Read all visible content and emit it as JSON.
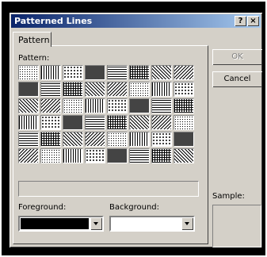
{
  "window": {
    "title": "Patterned Lines",
    "help_label": "?",
    "close_label": "×"
  },
  "tabs": [
    {
      "label": "Pattern"
    }
  ],
  "pattern_label": "Pattern:",
  "foreground": {
    "label": "Foreground:",
    "color": "#000000"
  },
  "background": {
    "label": "Background:",
    "color": "#ffffff"
  },
  "buttons": {
    "ok": "OK",
    "cancel": "Cancel"
  },
  "sample_label": "Sample:"
}
